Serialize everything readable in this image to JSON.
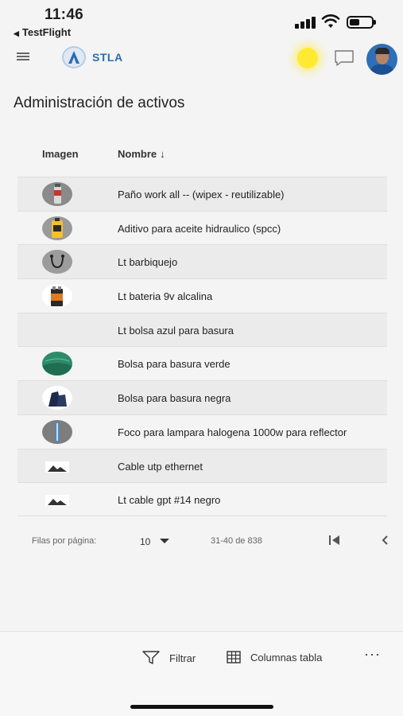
{
  "status_bar": {
    "time": "11:46",
    "back_app": "TestFlight",
    "signal_icon": "cellular-signal-icon",
    "wifi_icon": "wifi-icon",
    "battery_icon": "battery-icon",
    "battery_level": 0.35
  },
  "header": {
    "menu_icon": "hamburger-menu-icon",
    "logo_text": "STLA",
    "theme_icon": "sun-icon",
    "chat_icon": "chat-icon",
    "avatar": "user-avatar"
  },
  "page": {
    "title": "Administración de activos"
  },
  "table": {
    "columns": [
      "Imagen",
      "Nombre"
    ],
    "sort_indicator": "↓",
    "rows": [
      {
        "name": "Paño work all --  (wipex - reutilizable)",
        "thumb": "wipes-can"
      },
      {
        "name": "Aditivo para aceite hidraulico (spcc)",
        "thumb": "additive-bottle"
      },
      {
        "name": "Lt barbiquejo",
        "thumb": "chin-strap"
      },
      {
        "name": "Lt bateria 9v alcalina",
        "thumb": "battery-9v"
      },
      {
        "name": "Lt bolsa azul para basura",
        "thumb": "none"
      },
      {
        "name": "Bolsa para basura verde",
        "thumb": "green-bag"
      },
      {
        "name": "Bolsa para basura negra",
        "thumb": "black-bag"
      },
      {
        "name": "Foco para lampara halogena 1000w para reflector",
        "thumb": "halogen-bulb"
      },
      {
        "name": "Cable utp ethernet",
        "thumb": "image-placeholder"
      },
      {
        "name": "Lt cable gpt #14 negro",
        "thumb": "image-placeholder"
      }
    ]
  },
  "pagination": {
    "rows_label": "Filas por página:",
    "rows_value": "10",
    "range": "31-40 de 838"
  },
  "toolbar": {
    "filter_label": "Filtrar",
    "columns_label": "Columnas tabla",
    "more_label": "···"
  },
  "colors": {
    "accent": "#2c6eb0",
    "sun": "#ffea33"
  }
}
